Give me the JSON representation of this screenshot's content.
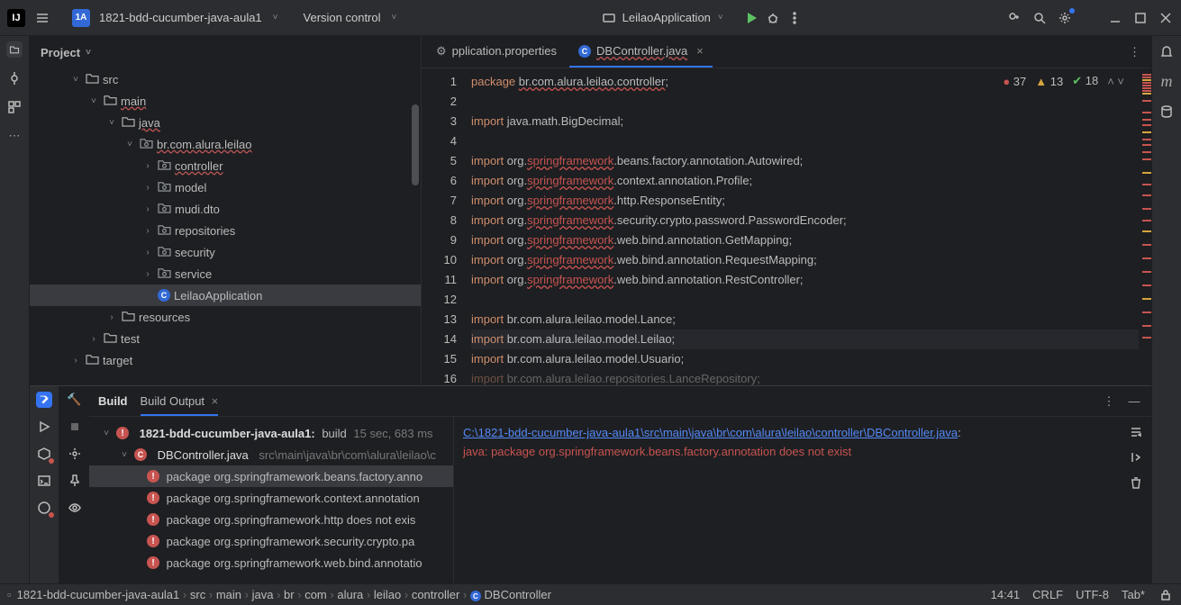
{
  "titlebar": {
    "project": "1821-bdd-cucumber-java-aula1",
    "projectBadge": "1A",
    "version": "Version control",
    "runConfig": "LeilaoApplication"
  },
  "project": {
    "header": "Project",
    "tree": [
      {
        "indent": 44,
        "tgl": "˅",
        "icon": "folder",
        "label": "src"
      },
      {
        "indent": 64,
        "tgl": "˅",
        "icon": "folder",
        "label": "main",
        "wavy": true
      },
      {
        "indent": 84,
        "tgl": "˅",
        "icon": "folder-blue",
        "label": "java",
        "wavy": true
      },
      {
        "indent": 104,
        "tgl": "˅",
        "icon": "pkg",
        "label": "br.com.alura.leilao",
        "wavy": true
      },
      {
        "indent": 124,
        "tgl": "›",
        "icon": "pkg",
        "label": "controller",
        "wavy": true
      },
      {
        "indent": 124,
        "tgl": "›",
        "icon": "pkg",
        "label": "model"
      },
      {
        "indent": 124,
        "tgl": "›",
        "icon": "pkg",
        "label": "mudi.dto"
      },
      {
        "indent": 124,
        "tgl": "›",
        "icon": "pkg",
        "label": "repositories"
      },
      {
        "indent": 124,
        "tgl": "›",
        "icon": "pkg",
        "label": "security"
      },
      {
        "indent": 124,
        "tgl": "›",
        "icon": "pkg",
        "label": "service"
      },
      {
        "indent": 124,
        "tgl": "",
        "icon": "class",
        "label": "LeilaoApplication",
        "sel": true
      },
      {
        "indent": 84,
        "tgl": "›",
        "icon": "folder",
        "label": "resources"
      },
      {
        "indent": 64,
        "tgl": "›",
        "icon": "folder",
        "label": "test"
      },
      {
        "indent": 44,
        "tgl": "›",
        "icon": "folder-orange",
        "label": "target"
      }
    ]
  },
  "editor": {
    "tabs": [
      {
        "label": "pplication.properties",
        "icon": "cog"
      },
      {
        "label": "DBController.java",
        "icon": "class",
        "active": true,
        "wavy": true
      }
    ],
    "lines": [
      {
        "n": 1,
        "html": "<span class='kw'>package</span> <span class='pkgline'>br.com.alura.leilao.controller</span>;"
      },
      {
        "n": 2,
        "html": ""
      },
      {
        "n": 3,
        "html": "<span class='kw'>import</span> java.math.BigDecimal;"
      },
      {
        "n": 4,
        "html": ""
      },
      {
        "n": 5,
        "html": "<span class='kw'>import</span> org.<span class='sf'>springframework</span>.beans.factory.annotation.Autowired;"
      },
      {
        "n": 6,
        "html": "<span class='kw'>import</span> org.<span class='sf'>springframework</span>.context.annotation.Profile;"
      },
      {
        "n": 7,
        "html": "<span class='kw'>import</span> org.<span class='sf'>springframework</span>.http.ResponseEntity;"
      },
      {
        "n": 8,
        "html": "<span class='kw'>import</span> org.<span class='sf'>springframework</span>.security.crypto.password.PasswordEncoder;"
      },
      {
        "n": 9,
        "html": "<span class='kw'>import</span> org.<span class='sf'>springframework</span>.web.bind.annotation.GetMapping;"
      },
      {
        "n": 10,
        "html": "<span class='kw'>import</span> org.<span class='sf'>springframework</span>.web.bind.annotation.RequestMapping;"
      },
      {
        "n": 11,
        "html": "<span class='kw'>import</span> org.<span class='sf'>springframework</span>.web.bind.annotation.RestController;"
      },
      {
        "n": 12,
        "html": ""
      },
      {
        "n": 13,
        "html": "<span class='kw'>import</span> br.com.alura.leilao.model.Lance;"
      },
      {
        "n": 14,
        "html": "<span class='kw'>import</span> br.com.alura.leilao.model.Leilao;",
        "hl": true
      },
      {
        "n": 15,
        "html": "<span class='kw'>import</span> br.com.alura.leilao.model.Usuario;"
      },
      {
        "n": 16,
        "html": "<span class='kw' style='opacity:.45'>import</span> <span style='opacity:.45'>br.com.alura.leilao.repositories.LanceRepository;</span>"
      }
    ],
    "insp": {
      "err": "37",
      "warn": "13",
      "ok": "18"
    }
  },
  "build": {
    "tabs": {
      "t1": "Build",
      "t2": "Build Output"
    },
    "root": "1821-bdd-cucumber-java-aula1:",
    "rootSuffix": "build",
    "rootTime": "15 sec, 683 ms",
    "file": "DBController.java",
    "filePath": "src\\main\\java\\br\\com\\alura\\leilao\\c",
    "errs": [
      "package org.springframework.beans.factory.anno",
      "package org.springframework.context.annotation",
      "package org.springframework.http does not exis",
      "package org.springframework.security.crypto.pa",
      "package org.springframework.web.bind.annotatio"
    ],
    "out": {
      "path": "C:\\1821-bdd-cucumber-java-aula1\\src\\main\\java\\br\\com\\alura\\leilao\\controller\\DBController.java",
      "colon": ":",
      "msg": "java: package org.springframework.beans.factory.annotation does not exist"
    }
  },
  "status": {
    "crumbs": [
      "1821-bdd-cucumber-java-aula1",
      "src",
      "main",
      "java",
      "br",
      "com",
      "alura",
      "leilao",
      "controller",
      "DBController"
    ],
    "pos": "14:41",
    "eol": "CRLF",
    "enc": "UTF-8",
    "indent": "Tab*"
  }
}
